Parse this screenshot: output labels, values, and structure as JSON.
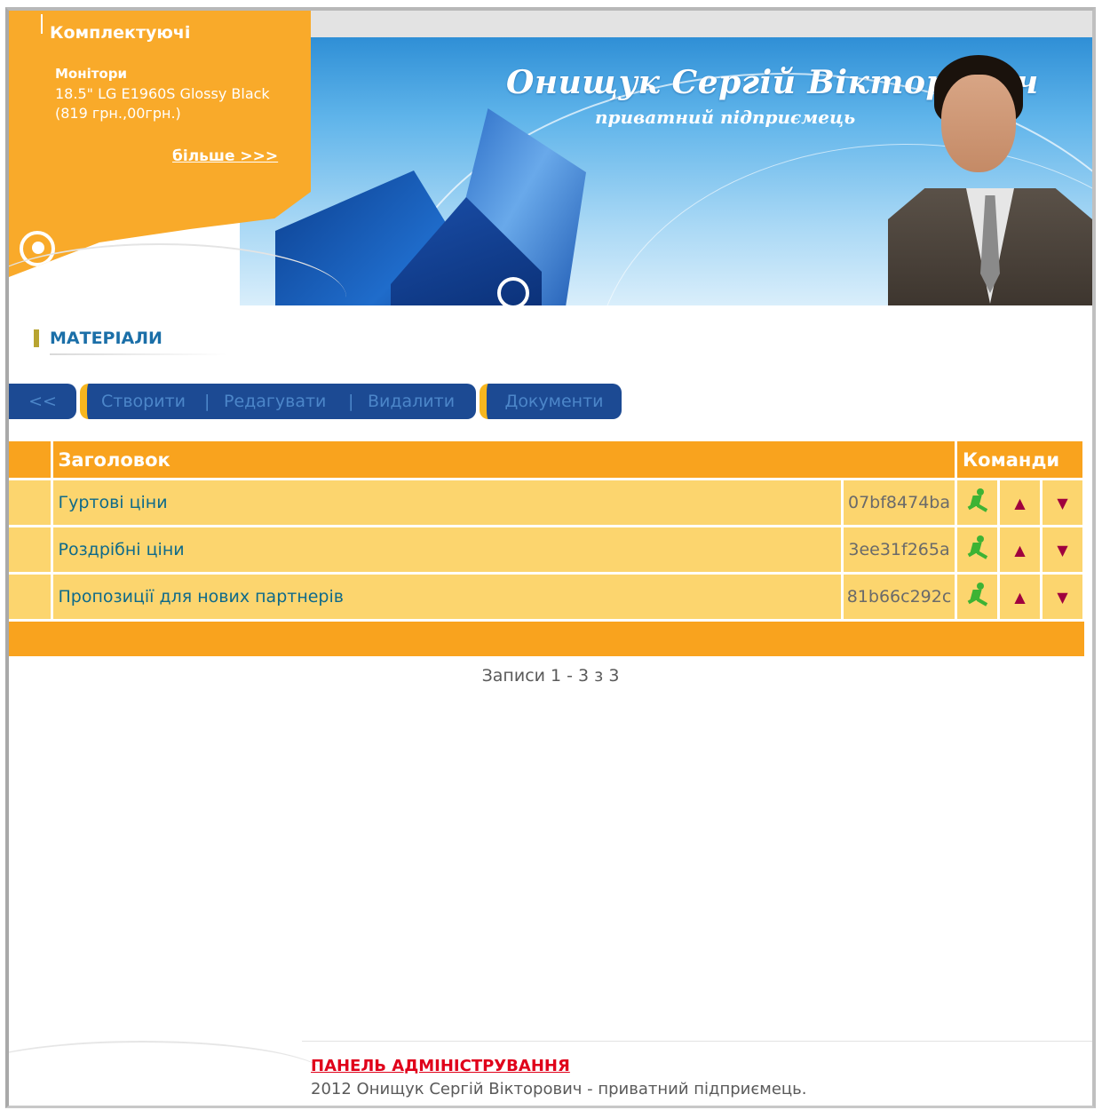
{
  "header": {
    "banner_title": "Онищук Сергій Вікторович",
    "banner_subtitle": "приватний підприємець"
  },
  "promo": {
    "title": "Комплектуючі",
    "category": "Монітори",
    "line1": "18.5\" LG E1960S Glossy Black",
    "line2": "(819 грн.,00грн.)",
    "more_link": "більше >>>"
  },
  "section": {
    "title": "МАТЕРІАЛИ"
  },
  "toolbar": {
    "back": "<<",
    "create": "Створити",
    "edit": "Редагувати",
    "delete": "Видалити",
    "documents": "Документи",
    "separator": "|"
  },
  "table": {
    "columns": {
      "title": "Заголовок",
      "commands": "Команди"
    },
    "rows": [
      {
        "title": "Гуртові ціни",
        "hash": "07bf8474ba"
      },
      {
        "title": "Роздрібні ціни",
        "hash": "3ee31f265a"
      },
      {
        "title": "Пропозиції для нових партнерів",
        "hash": "81b66c292c"
      }
    ]
  },
  "pagination": {
    "records_text": "Записи 1 - 3 з 3"
  },
  "footer": {
    "admin_link": "ПАНЕЛЬ АДМІНІСТРУВАННЯ",
    "copyright": "2012 Онищук Сергій Вікторович - приватний підприємець."
  },
  "colors": {
    "accent_orange": "#f9a31e",
    "row_yellow": "#fcd56e",
    "toolbar_blue": "#1c4a93",
    "link_red": "#e0001a"
  }
}
